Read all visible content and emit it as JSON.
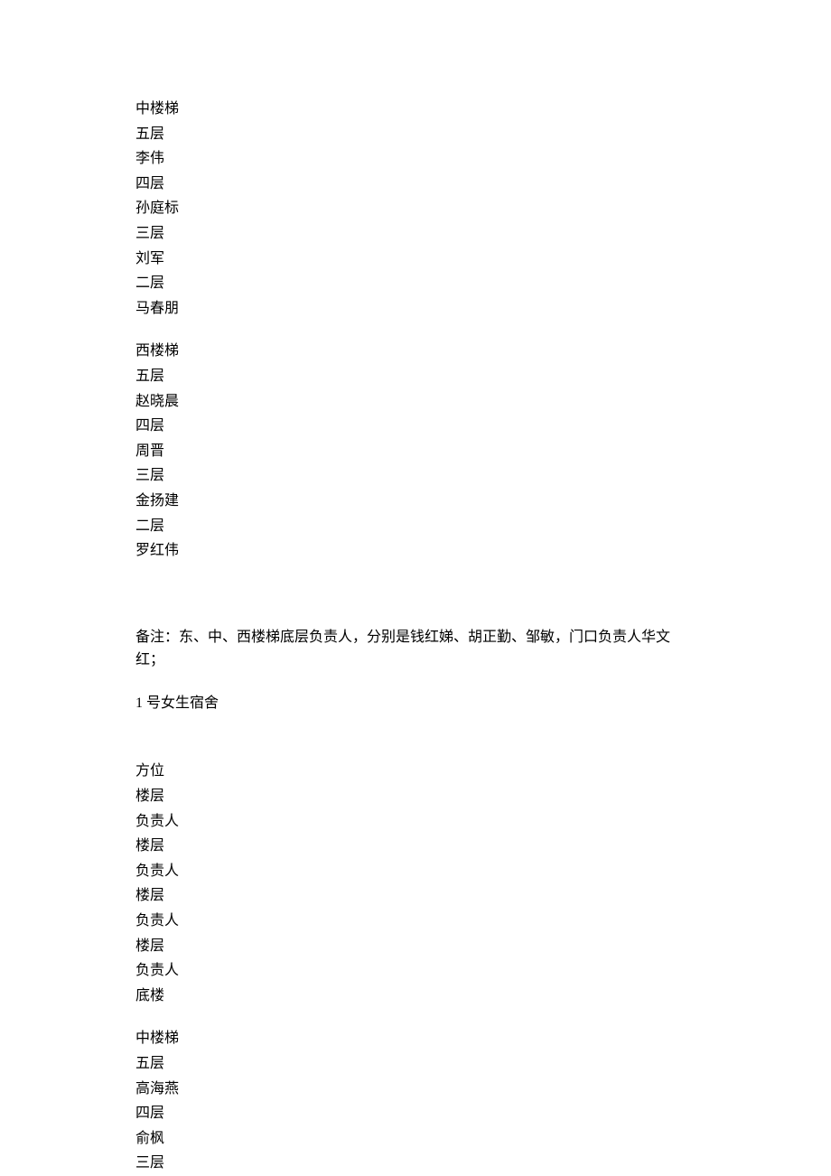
{
  "section1": {
    "title": "中楼梯",
    "floors": [
      {
        "floor": "五层",
        "person": "李伟"
      },
      {
        "floor": "四层",
        "person": "孙庭标"
      },
      {
        "floor": "三层",
        "person": "刘军"
      },
      {
        "floor": "二层",
        "person": "马春朋"
      }
    ]
  },
  "section2": {
    "title": "西楼梯",
    "floors": [
      {
        "floor": "五层",
        "person": "赵晓晨"
      },
      {
        "floor": "四层",
        "person": "周晋"
      },
      {
        "floor": "三层",
        "person": "金扬建"
      },
      {
        "floor": "二层",
        "person": "罗红伟"
      }
    ]
  },
  "note": "备注：东、中、西楼梯底层负责人，分别是钱红娣、胡正勤、邹敏，门口负责人华文红；",
  "dormTitle": "1 号女生宿舍",
  "labels": {
    "direction": "方位",
    "floor": "楼层",
    "person": "负责人",
    "ground": "底楼"
  },
  "section3": {
    "title": "中楼梯",
    "floors": [
      {
        "floor": "五层",
        "person": "高海燕"
      },
      {
        "floor": "四层",
        "person": "俞枫"
      },
      {
        "floor": "三层",
        "person": ""
      }
    ]
  }
}
